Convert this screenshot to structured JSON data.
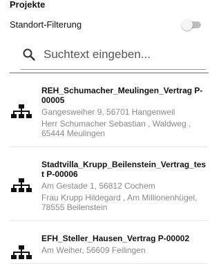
{
  "header": {
    "title": "Projekte"
  },
  "filter": {
    "label": "Standort-Filterung",
    "enabled": false
  },
  "search": {
    "placeholder": "Suchtext eingeben...",
    "value": ""
  },
  "projects": [
    {
      "title": "REH_Schumacher_Meulingen_Vertrag P-00005",
      "address": "Gangesweiher 9, 56701 Hangenweil",
      "client": "Herr Schumacher Sebastian , Waldweg , 65444 Meulingen",
      "icon": "sitemap-icon"
    },
    {
      "title": "Stadtvilla_Krupp_Beilenstein_Vertrag_test P-00006",
      "address": "Am Gestade 1, 56812 Cochem",
      "client": "Frau Krupp Hildegard , Am Millionenhügel, 78555 Beilenstein",
      "icon": "sitemap-icon"
    },
    {
      "title": "EFH_Steller_Hausen_Vertrag P-00002",
      "address": "Am Weiher, 56609 Feilingen",
      "client": "",
      "icon": "sitemap-icon"
    }
  ]
}
